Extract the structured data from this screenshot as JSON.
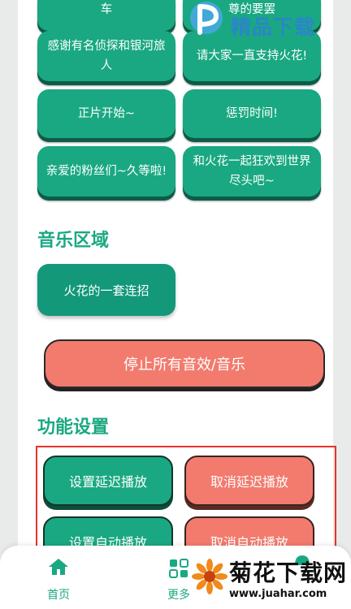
{
  "sound_buttons": [
    {
      "label": "车"
    },
    {
      "label": "尊的要罢"
    },
    {
      "label": "感谢有名侦探和银河旅人"
    },
    {
      "label": "请大家一直支持火花!"
    },
    {
      "label": "正片开始~"
    },
    {
      "label": "惩罚时间!"
    },
    {
      "label": "亲爱的粉丝们~久等啦!"
    },
    {
      "label": "和火花一起狂欢到世界尽头吧~"
    }
  ],
  "music_section": {
    "title": "音乐区域",
    "items": [
      {
        "label": "火花的一套连招"
      }
    ]
  },
  "stop_button": {
    "label": "停止所有音效/音乐"
  },
  "settings_section": {
    "title": "功能设置",
    "set_delay": "设置延迟播放",
    "cancel_delay": "取消延迟播放",
    "set_auto": "设置自动播放",
    "cancel_auto": "取消自动播放"
  },
  "bottom_nav": {
    "home": "首页",
    "more": "更多"
  },
  "watermark_top": {
    "text": "精品下载"
  },
  "watermark_bottom": {
    "text": "菊花下载网",
    "url": "www.juahar.com"
  },
  "colors": {
    "primary": "#1aa882",
    "danger": "#f27b6e",
    "highlight": "#e8322b"
  }
}
